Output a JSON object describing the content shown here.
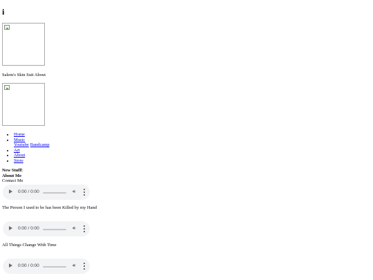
{
  "header": {
    "title": "i"
  },
  "site_title": "Salem's Skin Suit About",
  "nav": {
    "items": [
      "Home",
      "Music",
      "Art",
      "About",
      "Store"
    ],
    "music_sub": [
      "Youtube",
      "Bandcamp"
    ]
  },
  "sections": {
    "new_stuff": "New Stuff!",
    "about_me": "About Me",
    "contact": "Contact Me"
  },
  "players": [
    {
      "time": "0:00 / 0:00"
    },
    {
      "time": "0:00 / 0:00"
    },
    {
      "time": "0:00 / 0:00"
    }
  ],
  "tracks": [
    "The Person I used to be has been Killed by my Hand",
    "All Things Change With Time"
  ],
  "icons": {
    "play": "play-icon",
    "volume": "volume-icon",
    "more": "more-options-icon",
    "broken_image": "broken-image-icon"
  }
}
